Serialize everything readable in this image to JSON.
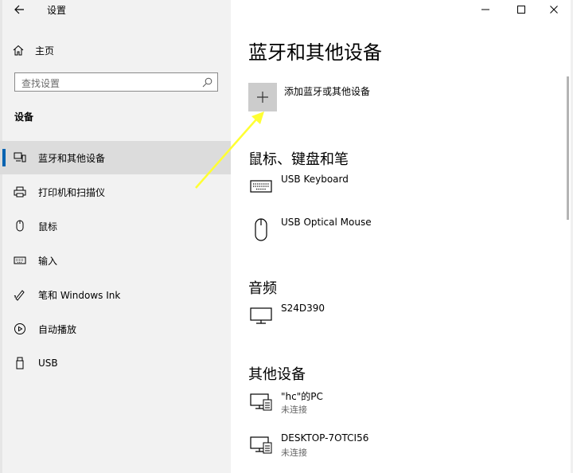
{
  "window": {
    "title": "设置",
    "controls": {
      "minimize": "minimize-icon",
      "maximize": "maximize-icon",
      "close": "close-icon"
    }
  },
  "sidebar": {
    "home_label": "主页",
    "search": {
      "placeholder": "查找设置"
    },
    "section_title": "设备",
    "items": [
      {
        "label": "蓝牙和其他设备",
        "icon": "bluetooth-devices-icon",
        "active": true
      },
      {
        "label": "打印机和扫描仪",
        "icon": "printer-icon",
        "active": false
      },
      {
        "label": "鼠标",
        "icon": "mouse-icon",
        "active": false
      },
      {
        "label": "输入",
        "icon": "keyboard-icon",
        "active": false
      },
      {
        "label": "笔和 Windows Ink",
        "icon": "pen-icon",
        "active": false
      },
      {
        "label": "自动播放",
        "icon": "autoplay-icon",
        "active": false
      },
      {
        "label": "USB",
        "icon": "usb-icon",
        "active": false
      }
    ]
  },
  "main": {
    "title": "蓝牙和其他设备",
    "add_device_label": "添加蓝牙或其他设备",
    "groups": [
      {
        "title": "鼠标、键盘和笔",
        "devices": [
          {
            "name": "USB Keyboard",
            "status": "",
            "icon": "keyboard-icon"
          },
          {
            "name": "USB Optical Mouse",
            "status": "",
            "icon": "mouse-icon"
          }
        ]
      },
      {
        "title": "音频",
        "devices": [
          {
            "name": "S24D390",
            "status": "",
            "icon": "monitor-icon"
          }
        ]
      },
      {
        "title": "其他设备",
        "devices": [
          {
            "name": "\"hc\"的PC",
            "status": "未连接",
            "icon": "network-pc-icon"
          },
          {
            "name": "DESKTOP-7OTCI56",
            "status": "未连接",
            "icon": "network-pc-icon"
          }
        ]
      }
    ]
  },
  "colors": {
    "accent": "#0063b1",
    "sidebar_bg": "#f2f2f2",
    "active_bg": "#dcdcdc",
    "annotation_arrow": "#ffff33"
  }
}
